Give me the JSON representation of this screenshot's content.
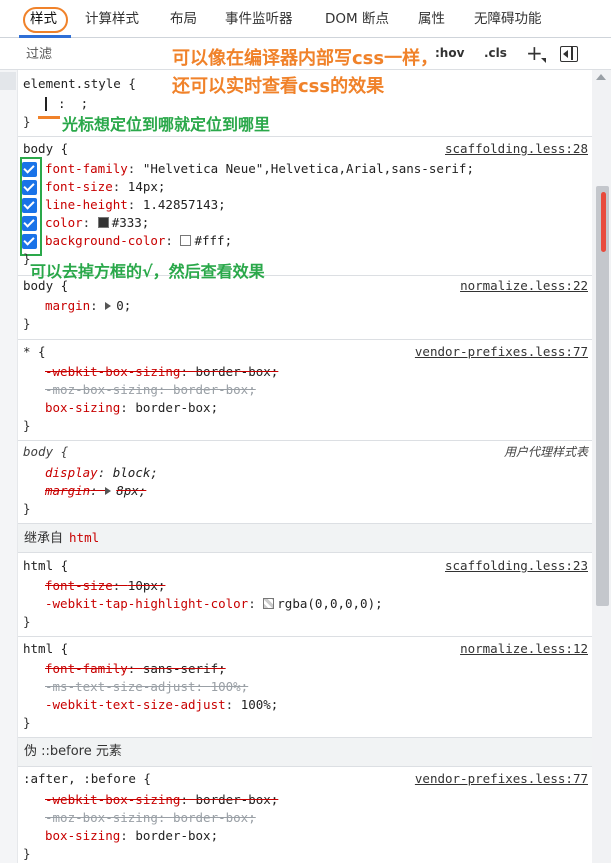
{
  "tabs": [
    {
      "label": "样式",
      "active": true
    },
    {
      "label": "计算样式",
      "active": false
    },
    {
      "label": "布局",
      "active": false
    },
    {
      "label": "事件监听器",
      "active": false
    },
    {
      "label": "DOM 断点",
      "active": false
    },
    {
      "label": "属性",
      "active": false
    },
    {
      "label": "无障碍功能",
      "active": false
    }
  ],
  "filter": {
    "placeholder": "过滤",
    "hov": ":hov",
    "cls": ".cls",
    "plus": "+"
  },
  "colors": {
    "accent": "#1a73e8",
    "property": "#c80000",
    "annotation_orange": "#f0822a",
    "annotation_green": "#2aa84a"
  },
  "icons": {
    "add": "plus-icon",
    "toggle_sidebar": "sidebar-toggle-icon",
    "checkbox": "checkbox-icon"
  },
  "annotations": {
    "editor_line1": "可以像在编译器内部写css一样，",
    "editor_line2": "还可以实时查看css的效果",
    "cursor": "光标想定位到哪就定位到哪里",
    "checkbox": "可以去掉方框的√，然后查看效果"
  },
  "rules": {
    "element_style": {
      "selector": "element.style {",
      "body": ":  ;",
      "close": "}"
    },
    "body1": {
      "selector": "body {",
      "source": "scaffolding.less:28",
      "decls": [
        {
          "prop": "font-family",
          "value": "\"Helvetica Neue\",Helvetica,Arial,sans-serif;"
        },
        {
          "prop": "font-size",
          "value": "14px;"
        },
        {
          "prop": "line-height",
          "value": "1.42857143;"
        },
        {
          "prop": "color",
          "value": "#333;",
          "swatch": "#333333"
        },
        {
          "prop": "background-color",
          "value": "#fff;",
          "swatch": "#ffffff"
        }
      ],
      "close": "}"
    },
    "body2": {
      "selector": "body {",
      "source": "normalize.less:22",
      "prop": "margin",
      "value": "0;",
      "close": "}"
    },
    "star": {
      "selector": "* {",
      "source": "vendor-prefixes.less:77",
      "decls": [
        {
          "prop": "-webkit-box-sizing",
          "value": "border-box;"
        },
        {
          "prop": "-moz-box-sizing",
          "value": "border-box;"
        },
        {
          "prop": "box-sizing",
          "value": "border-box;"
        }
      ],
      "close": "}"
    },
    "ua_body": {
      "selector": "body {",
      "source": "用户代理样式表",
      "decls": [
        {
          "prop": "display",
          "value": "block;"
        },
        {
          "prop": "margin",
          "value": "8px;"
        }
      ],
      "close": "}"
    },
    "inherited_html": {
      "label": "继承自",
      "tag": "html"
    },
    "html1": {
      "selector": "html {",
      "source": "scaffolding.less:23",
      "decls": [
        {
          "prop": "font-size",
          "value": "10px;"
        },
        {
          "prop": "-webkit-tap-highlight-color",
          "value": "rgba(0,0,0,0);",
          "swatch": "transparent"
        }
      ],
      "close": "}"
    },
    "html2": {
      "selector": "html {",
      "source": "normalize.less:12",
      "decls": [
        {
          "prop": "font-family",
          "value": "sans-serif;"
        },
        {
          "prop": "-ms-text-size-adjust",
          "value": "100%;"
        },
        {
          "prop": "-webkit-text-size-adjust",
          "value": "100%;"
        }
      ],
      "close": "}"
    },
    "pseudo_head": {
      "label": "伪 ::before 元素"
    },
    "after_before": {
      "selector": ":after, :before {",
      "source": "vendor-prefixes.less:77",
      "decls": [
        {
          "prop": "-webkit-box-sizing",
          "value": "border-box;"
        },
        {
          "prop": "-moz-box-sizing",
          "value": "border-box;"
        },
        {
          "prop": "box-sizing",
          "value": "border-box;"
        }
      ],
      "close": "}"
    }
  }
}
